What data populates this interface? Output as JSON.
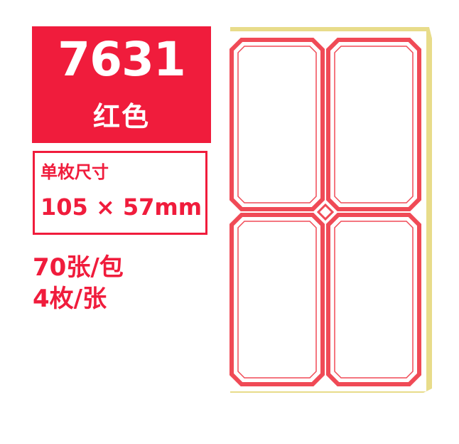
{
  "product": {
    "model_code": "7631",
    "color_name": "红色",
    "size_label": "单枚尺寸",
    "size_value": "105 × 57mm",
    "sheets_per_pack": "70张/包",
    "labels_per_sheet": "4枚/张"
  },
  "colors": {
    "accent_red": "#f01c3c",
    "label_border": "#f04a56",
    "sheet_backing": "#e8dc8a"
  }
}
